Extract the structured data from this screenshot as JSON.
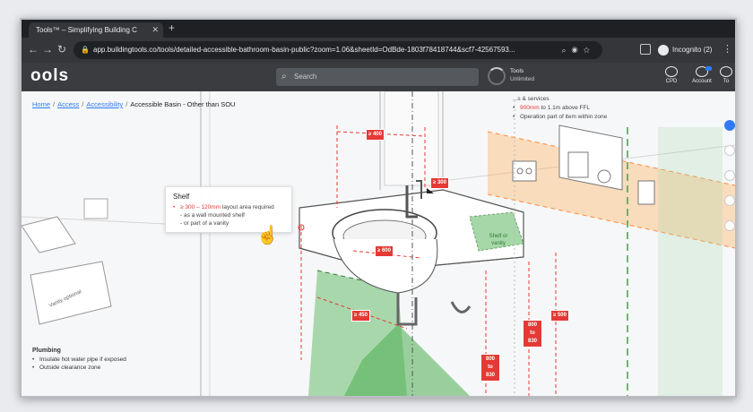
{
  "browser": {
    "tab_title": "Tools™ – Simplifying Building C",
    "tab_close": "✕",
    "new_tab": "+",
    "url": "app.buildingtools.co/tools/detailed-accessible-bathroom-basin-public?zoom=1.06&sheetId=OdBde-1803f78418744&scf7-42567593...",
    "incognito_label": "Incognito (2)"
  },
  "app": {
    "logo": "ools",
    "search_placeholder": "Search",
    "plan_title": "Tools",
    "plan_status": "Unlimited",
    "cpd_label": "CPD",
    "account_label": "Account",
    "tools_label": "To"
  },
  "breadcrumb": {
    "items": [
      "Home",
      "Access",
      "Accessibility"
    ],
    "current": "Accessible Basin - Other than SOU"
  },
  "tooltip": {
    "title": "Shelf",
    "line1_highlight": "≥ 300 – 120mm",
    "line1_rest": " layout area required",
    "line2": "- as a wall mounted shelf",
    "line3": "- or part of a vanity"
  },
  "plumbing": {
    "title": "Plumbing",
    "items": [
      "Insulate hot water pipe if exposed",
      "Outside clearance zone"
    ]
  },
  "top_right_note": {
    "heading": "...s & services",
    "line1_highlight": "900mm",
    "line1_rest": " to 1.1m above FFL",
    "line2": "Operation part of item within zone"
  },
  "labels": {
    "shelf": "Shelf or vanity",
    "vanity": "Vanity optional",
    "dims": {
      "top_a": "≥ 400",
      "top_b": "≥ 300",
      "basin": "≥ 600",
      "floor": "≥ 450",
      "right1": "≥ 500",
      "right2": "800 to 830",
      "bottom": "800 to 830"
    }
  },
  "colors": {
    "accent_red": "#e53935",
    "clearance_green": "#4caf50",
    "reach_orange": "#ffa94d",
    "header_bg": "#3a3c40",
    "link_blue": "#2f7bf5"
  }
}
